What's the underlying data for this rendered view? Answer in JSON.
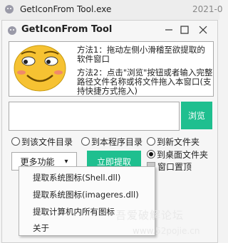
{
  "desktop": {
    "title": "GetIconFrom Tool.exe",
    "date": "2021-0"
  },
  "window": {
    "title": "GetIconFrom Tool"
  },
  "info": {
    "method1": "方法1：拖动左侧小滑稽至欲提取的软件窗口",
    "method2": "方法2：点击\"浏览\"按钮或者输入完整路径文件名称或将文件拖入本窗口(支持快捷方式拖入)"
  },
  "path_input": {
    "value": ""
  },
  "browse_label": "浏览",
  "radios": {
    "file_dir": "到该文件目录",
    "program_dir": "到本程序目录",
    "new_folder": "到新文件夹",
    "desktop_folder": "到桌面文件夹"
  },
  "topmost_label": "窗口置顶",
  "more_button": {
    "label": "更多功能",
    "arrow": "▾"
  },
  "extract_button": "立即提取",
  "menu": [
    "提取系统图标(Shell.dll)",
    "提取系统图标(imageres.dll)",
    "提取计算机内所有图标",
    "关于"
  ],
  "watermark": {
    "line1": "吾爱破解论坛",
    "line2": "www.52pojie.cn"
  },
  "colors": {
    "accent": "#1fbf8f",
    "emoji": "#f6c232"
  }
}
